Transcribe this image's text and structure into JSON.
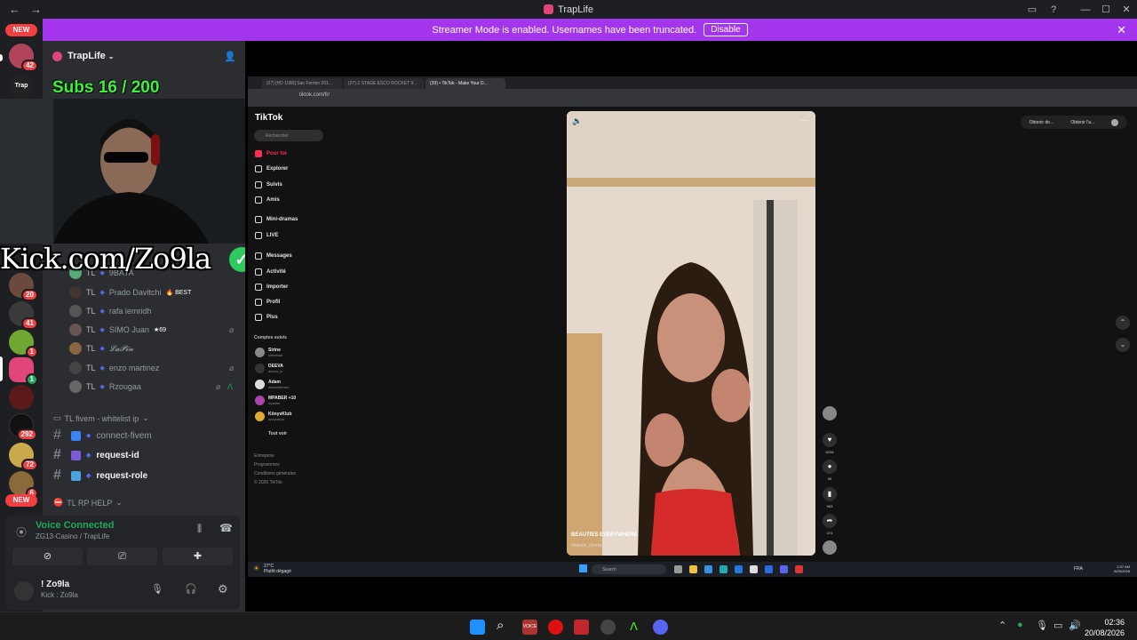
{
  "window": {
    "title": "TrapLife",
    "back": "←",
    "forward": "→"
  },
  "banner": {
    "text": "Streamer Mode is enabled. Usernames have been truncated.",
    "button": "Disable"
  },
  "rail": {
    "new_top": "NEW",
    "new_bottom": "NEW",
    "badges": [
      "42",
      "20",
      "41",
      "1",
      "1",
      "292",
      "72",
      "6"
    ]
  },
  "sidebar": {
    "server_name": "TrapLife",
    "members": [
      {
        "tag": "TL",
        "name": "9BAYA"
      },
      {
        "tag": "TL",
        "name": "Prado Davitchi",
        "extra": "🔥 BEST"
      },
      {
        "tag": "TL",
        "name": "rafa lemridh"
      },
      {
        "tag": "TL",
        "name": "SIMO Juan",
        "extra": "★69"
      },
      {
        "tag": "TL",
        "name": "𝓛𝓪𝓟𝓲𝓷"
      },
      {
        "tag": "TL",
        "name": "enzo martinez"
      },
      {
        "tag": "TL",
        "name": "Rzougaa"
      }
    ],
    "category1": "TL fivem - whitelist ip",
    "channels": [
      {
        "name": "connect-fivem"
      },
      {
        "name": "request-id"
      },
      {
        "name": "request-role"
      }
    ],
    "category2": "TL RP HELP"
  },
  "overlay": {
    "subs": "Subs 16 / 200",
    "kick": "Kick.com/Zo9la",
    "check": "✓"
  },
  "voice": {
    "status": "Voice Connected",
    "channel": "ZG13-Casino / TrapLife"
  },
  "user": {
    "name": "! Zo9la",
    "status": "Kick : Zo9la"
  },
  "browser": {
    "tabs": [
      "(27) [HD 1080] San Fermin 201...",
      "(27) Z STAGE ESCO ROCKET 9...",
      "(39) • TikTok - Make Your D..."
    ],
    "url": "tiktok.com/fr/"
  },
  "tiktok": {
    "logo": "TikTok",
    "search_placeholder": "Rechercher",
    "nav": [
      "Pour toi",
      "Explorer",
      "Suivis",
      "Amis",
      "Mini-dramas",
      "LIVE",
      "Messages",
      "Activité",
      "Importer",
      "Profil",
      "Plus"
    ],
    "followed_title": "Comptes suivis",
    "followed": [
      {
        "name": "Sirine",
        "sub": "sirinebae"
      },
      {
        "name": "DEEVA",
        "sub": "deeva_io"
      },
      {
        "name": "Adam",
        "sub": "adamimeraru"
      },
      {
        "name": "MPABER +10",
        "sub": "mpaber"
      },
      {
        "name": "KönyvKlub",
        "sub": "konyvklub"
      }
    ],
    "see_all": "Tout voir",
    "footer": [
      "Entreprise",
      "Programmes",
      "Conditions générales",
      "© 2026 TikTok"
    ],
    "top_buttons": [
      "Obtenir de...",
      "Obtenir l'a..."
    ],
    "video_caption": "BEAUTIES EVERYWHERE",
    "video_user": "#baisez_chomell",
    "counts": [
      "6228",
      "55",
      "963",
      "474"
    ]
  },
  "inner_taskbar": {
    "weather": "27°C",
    "weather_sub": "Plutôt dégagé",
    "search": "Search",
    "lang": "FRA",
    "time": "2:37 AM",
    "date": "8/20/2026"
  },
  "taskbar": {
    "time": "02:36",
    "date": "20/08/2026"
  }
}
